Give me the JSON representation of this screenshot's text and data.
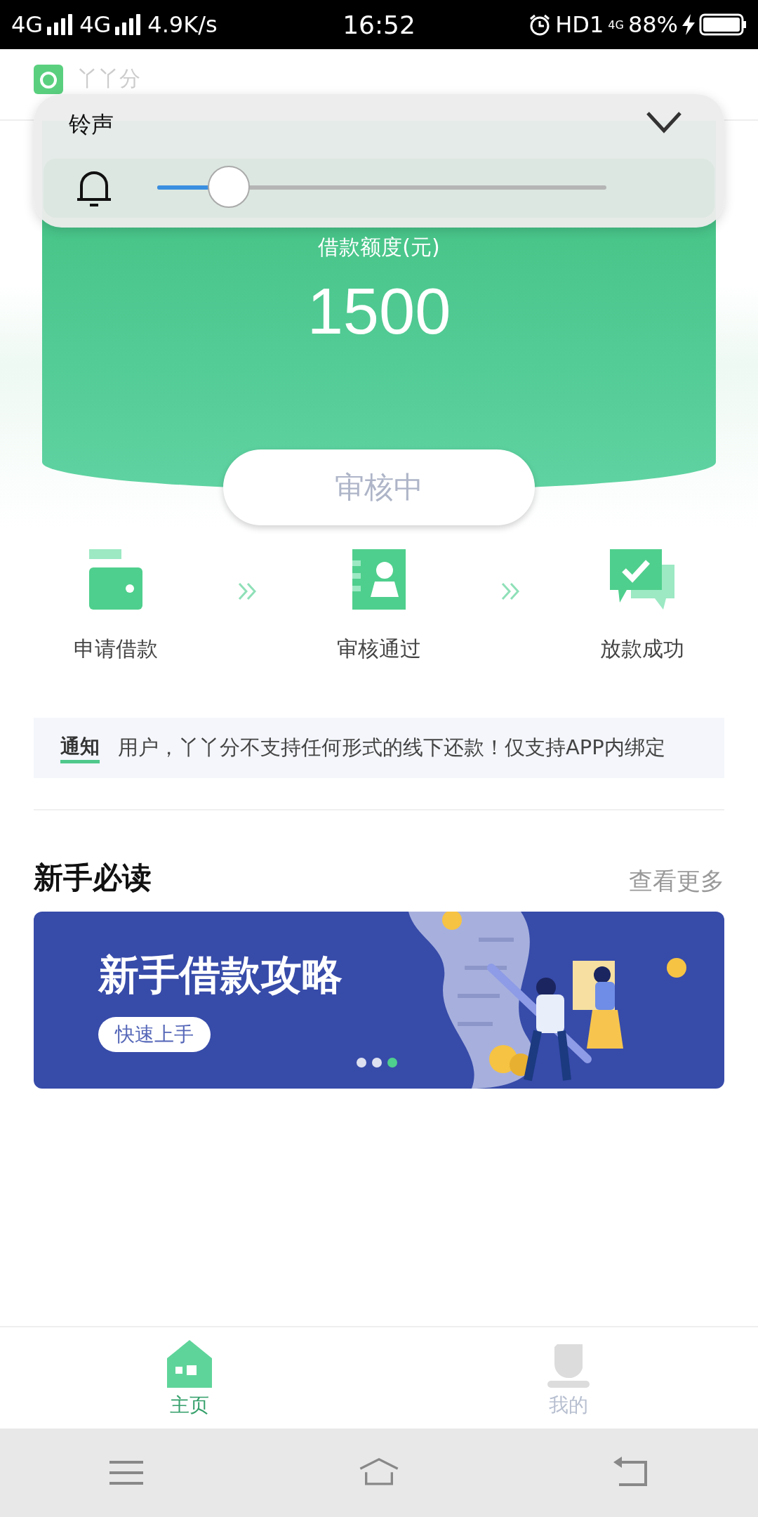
{
  "status_bar": {
    "network_1": "4G",
    "network_2": "4G",
    "speed": "4.9K/s",
    "time": "16:52",
    "hd": "HD1",
    "network_3": "4G",
    "battery": "88%"
  },
  "app_header": {
    "title": "丫丫分"
  },
  "volume_panel": {
    "title": "铃声",
    "level": 0.16
  },
  "credit_card": {
    "label": "借款额度(元)",
    "amount": "1500",
    "status_button": "审核中"
  },
  "steps": [
    {
      "label": "申请借款",
      "kind": "wallet"
    },
    {
      "label": "审核通过",
      "kind": "contact"
    },
    {
      "label": "放款成功",
      "kind": "chat"
    }
  ],
  "notice": {
    "tag": "通知",
    "text": "用户，丫丫分不支持任何形式的线下还款！仅支持APP内绑定"
  },
  "section": {
    "title": "新手必读",
    "more": "查看更多"
  },
  "banner": {
    "title": "新手借款攻略",
    "button": "快速上手",
    "dots": [
      {
        "selected": false
      },
      {
        "selected": false
      },
      {
        "selected": true
      }
    ]
  },
  "tab_bar": [
    {
      "label": "主页",
      "selected": true,
      "kind": "home"
    },
    {
      "label": "我的",
      "selected": false,
      "kind": "profile"
    }
  ]
}
